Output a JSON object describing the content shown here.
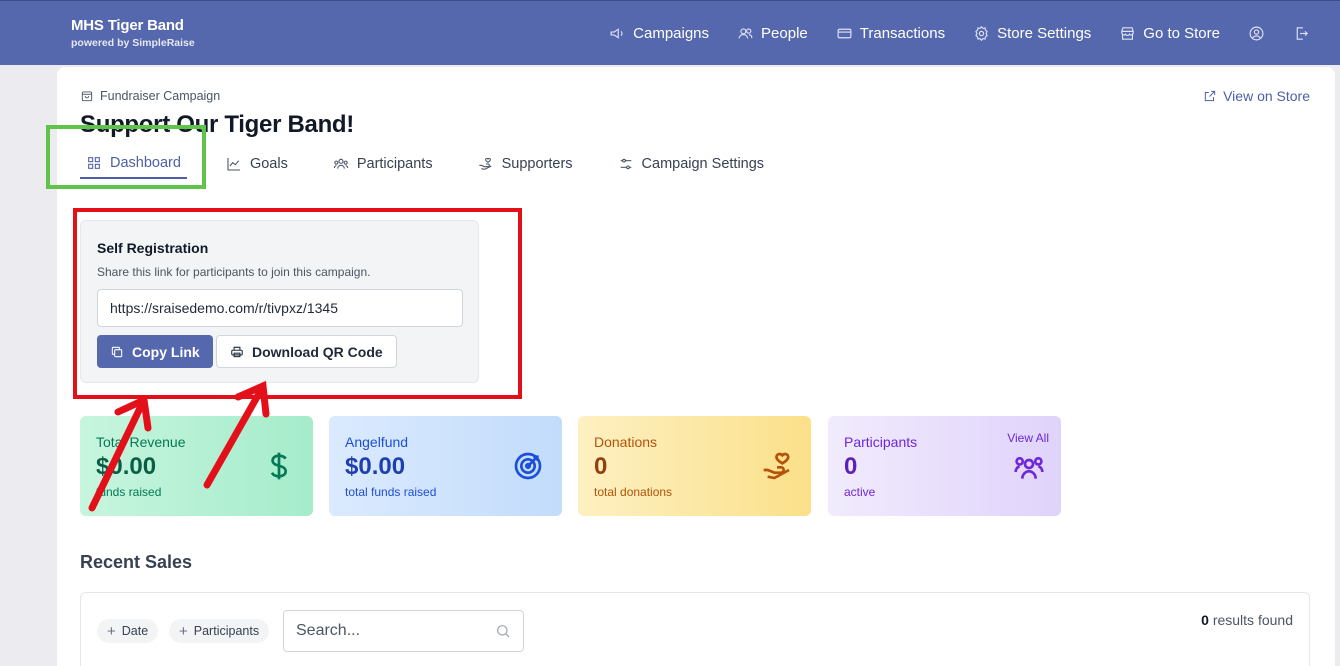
{
  "header": {
    "brand_name": "MHS Tiger Band",
    "brand_sub": "powered by SimpleRaise",
    "nav": {
      "campaigns": "Campaigns",
      "people": "People",
      "transactions": "Transactions",
      "store_settings": "Store Settings",
      "go_to_store": "Go to Store"
    }
  },
  "page": {
    "breadcrumb": "Fundraiser Campaign",
    "title": "Support Our Tiger Band!",
    "view_on_store": "View on Store"
  },
  "tabs": {
    "dashboard": "Dashboard",
    "goals": "Goals",
    "participants": "Participants",
    "supporters": "Supporters",
    "campaign_settings": "Campaign Settings"
  },
  "self_registration": {
    "title": "Self Registration",
    "description": "Share this link for participants to join this campaign.",
    "link": "https://sraisedemo.com/r/tivpxz/1345",
    "copy_label": "Copy Link",
    "qr_label": "Download QR Code"
  },
  "stats": {
    "revenue": {
      "label": "Total Revenue",
      "value": "$0.00",
      "sub": "funds raised"
    },
    "angelfund": {
      "label": "Angelfund",
      "value": "$0.00",
      "sub": "total funds raised"
    },
    "donations": {
      "label": "Donations",
      "value": "0",
      "sub": "total donations"
    },
    "participants": {
      "label": "Participants",
      "value": "0",
      "sub": "active",
      "view_all": "View All"
    }
  },
  "recent_sales": {
    "title": "Recent Sales",
    "filter_date": "Date",
    "filter_participants": "Participants",
    "search_placeholder": "Search...",
    "results_count": "0",
    "results_text": " results found"
  },
  "colors": {
    "nav_bg": "#5567ad",
    "accent": "#4e5fa5",
    "highlight_green": "#5ec44a",
    "highlight_red": "#e3101a"
  }
}
